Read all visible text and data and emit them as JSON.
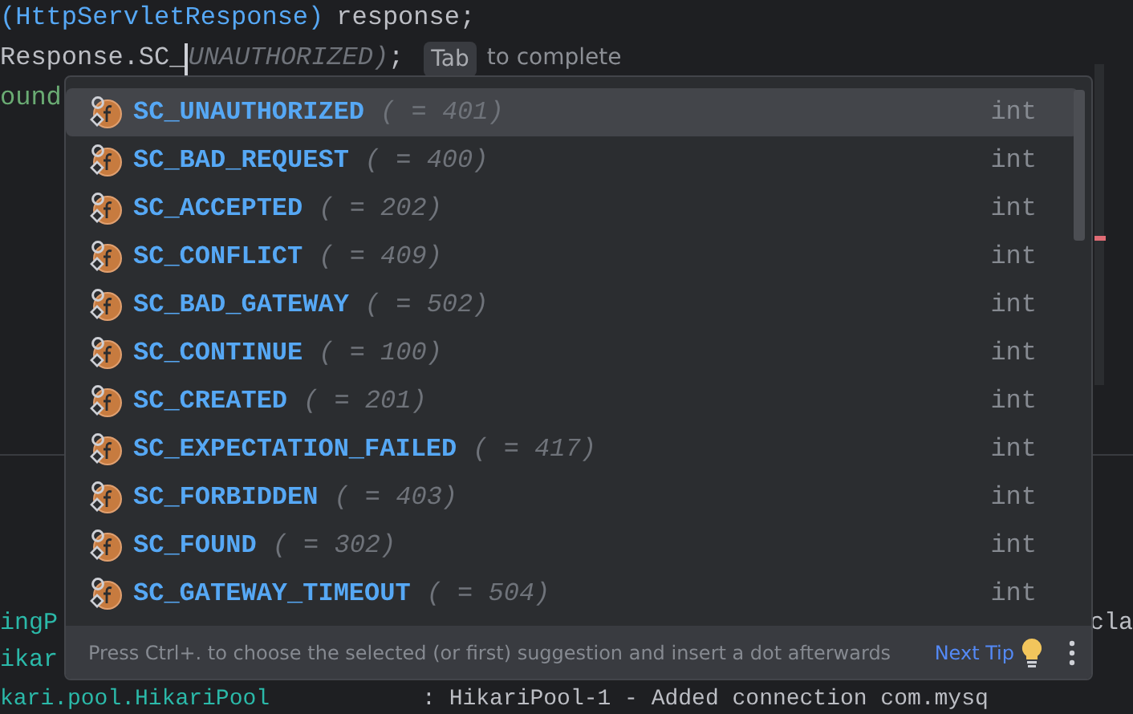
{
  "editor": {
    "line_1": {
      "paren": "(HttpServletResponse)",
      "rest": "response;"
    },
    "line_2": {
      "typed": "Response.SC_",
      "ghost": "UNAUTHORIZED)",
      "tail": ";",
      "hint_key": "Tab",
      "hint_text": "to complete"
    },
    "line_3": {
      "text": "ound"
    }
  },
  "console": {
    "lines": [
      {
        "left": "ingP",
        "right": "cla"
      },
      {
        "left": "ikar"
      },
      {
        "left": "kari.pool.HikariPool",
        "right": ": HikariPool-1 - Added connection com.mysq"
      }
    ]
  },
  "completion": {
    "items": [
      {
        "name": "SC_UNAUTHORIZED",
        "value": "( = 401)",
        "type": "int",
        "selected": true
      },
      {
        "name": "SC_BAD_REQUEST",
        "value": "( = 400)",
        "type": "int",
        "selected": false
      },
      {
        "name": "SC_ACCEPTED",
        "value": "( = 202)",
        "type": "int",
        "selected": false
      },
      {
        "name": "SC_CONFLICT",
        "value": "( = 409)",
        "type": "int",
        "selected": false
      },
      {
        "name": "SC_BAD_GATEWAY",
        "value": "( = 502)",
        "type": "int",
        "selected": false
      },
      {
        "name": "SC_CONTINUE",
        "value": "( = 100)",
        "type": "int",
        "selected": false
      },
      {
        "name": "SC_CREATED",
        "value": "( = 201)",
        "type": "int",
        "selected": false
      },
      {
        "name": "SC_EXPECTATION_FAILED",
        "value": "( = 417)",
        "type": "int",
        "selected": false
      },
      {
        "name": "SC_FORBIDDEN",
        "value": "( = 403)",
        "type": "int",
        "selected": false
      },
      {
        "name": "SC_FOUND",
        "value": "( = 302)",
        "type": "int",
        "selected": false
      },
      {
        "name": "SC_GATEWAY_TIMEOUT",
        "value": "( = 504)",
        "type": "int",
        "selected": false
      }
    ],
    "footer": {
      "hint": "Press Ctrl+. to choose the selected (or first) suggestion and insert a dot afterwards",
      "link": "Next Tip"
    }
  }
}
